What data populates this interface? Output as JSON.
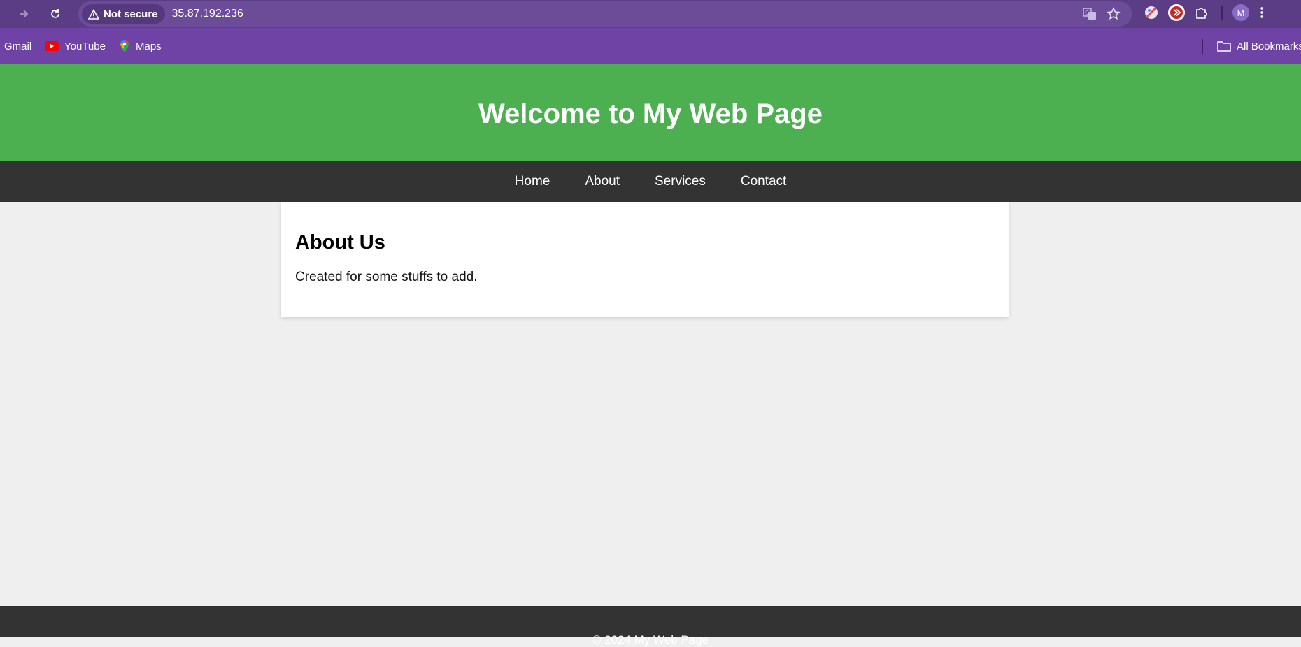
{
  "browser": {
    "security_label": "Not secure",
    "url": "35.87.192.236",
    "profile_initial": "M",
    "bookmarks": [
      {
        "label": "Gmail",
        "icon": "gmail-icon"
      },
      {
        "label": "YouTube",
        "icon": "youtube-icon"
      },
      {
        "label": "Maps",
        "icon": "maps-icon"
      }
    ],
    "all_bookmarks_label": "All Bookmarks",
    "colors": {
      "toolbar": "#5b3d86",
      "bookmarks_bar": "#6f42a6"
    }
  },
  "page": {
    "header_title": "Welcome to My Web Page",
    "nav": [
      "Home",
      "About",
      "Services",
      "Contact"
    ],
    "section_title": "About Us",
    "section_text": "Created for some stuffs to add.",
    "footer_text": "© 2024 My Web Page",
    "colors": {
      "header": "#4caf50",
      "nav": "#333333",
      "background": "#efefef"
    }
  }
}
